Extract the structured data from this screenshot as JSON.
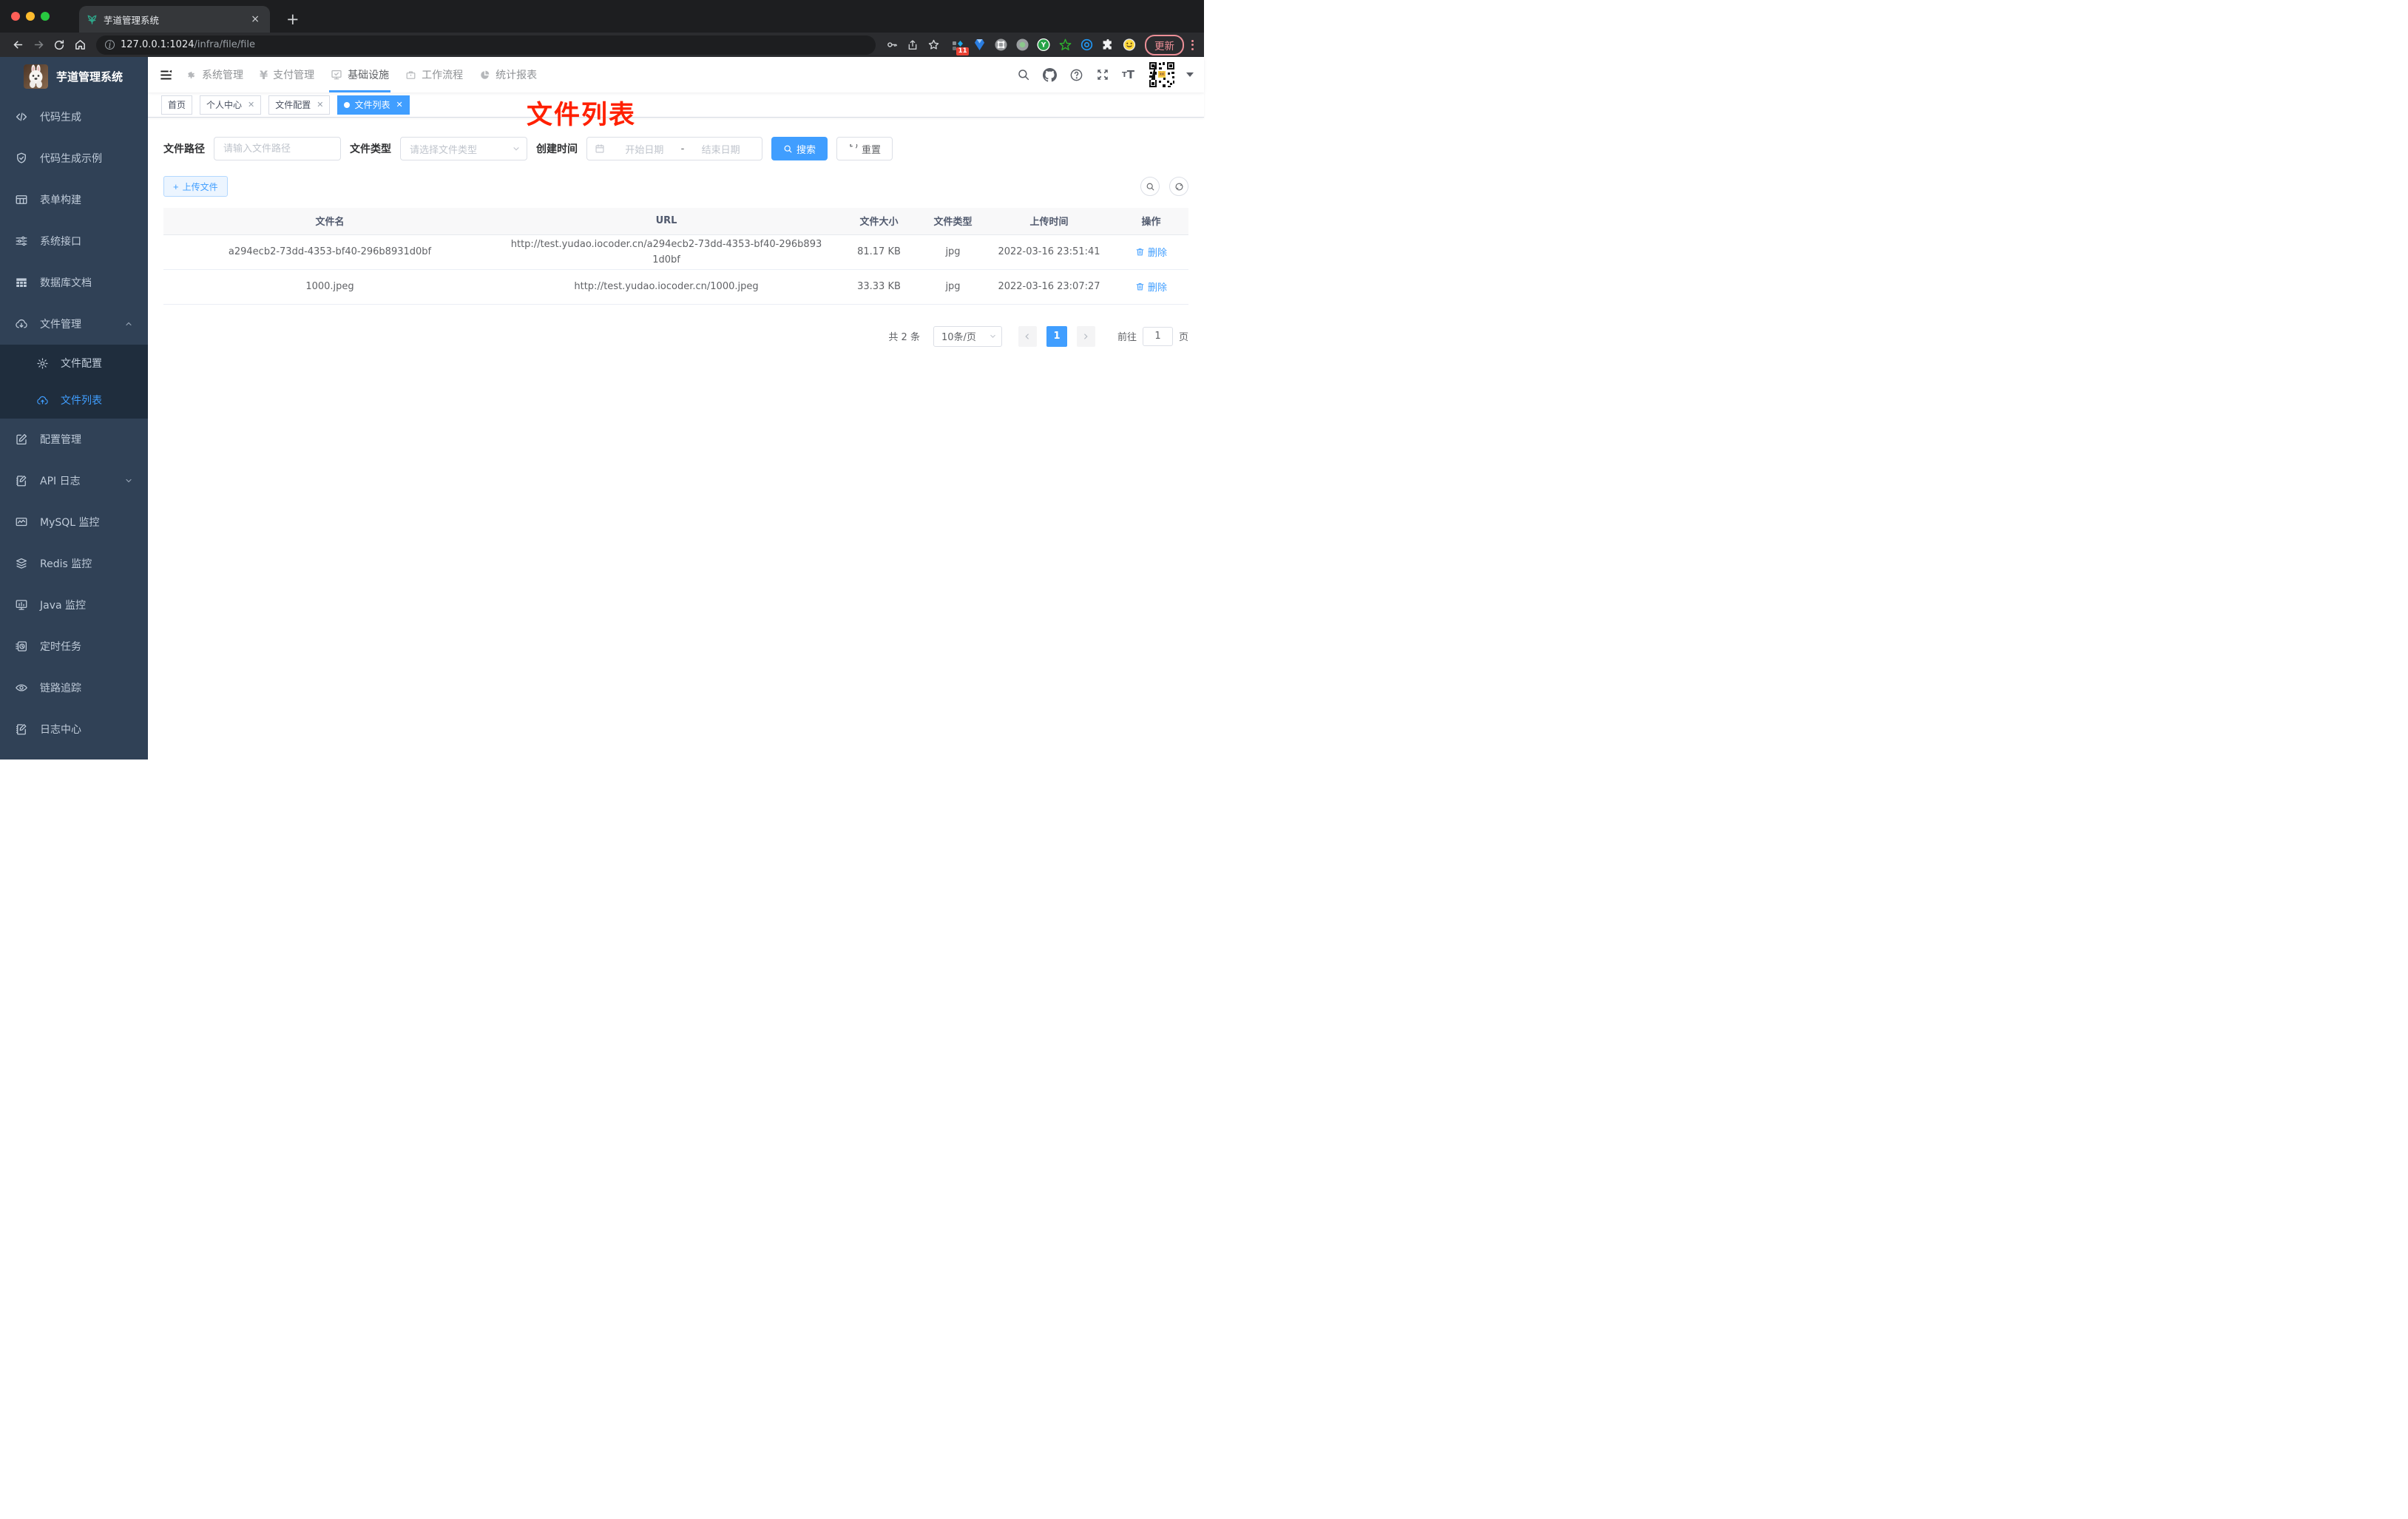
{
  "colors": {
    "accent": "#409eff",
    "sidebar_bg": "#304156",
    "submenu_bg": "#1f2d3d",
    "sidebar_text": "#bfcbd9",
    "annotation_red": "#ff2000",
    "table_header_bg": "#f8f8f9"
  },
  "browser": {
    "tab_title": "芋道管理系统",
    "close_tab": "×",
    "new_tab": "+",
    "url_host": "127.0.0.1:1024",
    "url_path": "/infra/file/file",
    "ext_badge": "11",
    "update_label": "更新"
  },
  "sidebar": {
    "title": "芋道管理系统",
    "items": [
      {
        "label": "代码生成",
        "icon": "code-icon"
      },
      {
        "label": "代码生成示例",
        "icon": "shield-check-icon"
      },
      {
        "label": "表单构建",
        "icon": "form-grid-icon"
      },
      {
        "label": "系统接口",
        "icon": "sliders-icon"
      },
      {
        "label": "数据库文档",
        "icon": "db-table-icon"
      },
      {
        "label": "文件管理",
        "icon": "cloud-download-icon",
        "expanded": true
      },
      {
        "label": "文件配置",
        "icon": "gear-icon",
        "sub": true
      },
      {
        "label": "文件列表",
        "icon": "cloud-upload-icon",
        "sub": true,
        "active": true
      },
      {
        "label": "配置管理",
        "icon": "edit-icon"
      },
      {
        "label": "API 日志",
        "icon": "log-edit-icon",
        "collapsed": true
      },
      {
        "label": "MySQL 监控",
        "icon": "chart-monitor-icon"
      },
      {
        "label": "Redis 监控",
        "icon": "layers-icon"
      },
      {
        "label": "Java 监控",
        "icon": "monitor-bars-icon"
      },
      {
        "label": "定时任务",
        "icon": "schedule-icon"
      },
      {
        "label": "链路追踪",
        "icon": "eye-icon"
      },
      {
        "label": "日志中心",
        "icon": "log-edit-icon"
      }
    ]
  },
  "topnav": {
    "items": [
      {
        "label": "系统管理",
        "icon": "gear-icon"
      },
      {
        "label": "支付管理",
        "icon": "yen-icon"
      },
      {
        "label": "基础设施",
        "icon": "monitor-check-icon",
        "active": true
      },
      {
        "label": "工作流程",
        "icon": "briefcase-icon"
      },
      {
        "label": "统计报表",
        "icon": "pie-chart-icon"
      }
    ]
  },
  "tags": [
    {
      "label": "首页",
      "closable": false
    },
    {
      "label": "个人中心",
      "closable": true
    },
    {
      "label": "文件配置",
      "closable": true
    },
    {
      "label": "文件列表",
      "closable": true,
      "active": true
    }
  ],
  "annotation": "文件列表",
  "filters": {
    "path_label": "文件路径",
    "path_placeholder": "请输入文件路径",
    "type_label": "文件类型",
    "type_placeholder": "请选择文件类型",
    "date_label": "创建时间",
    "date_start": "开始日期",
    "date_separator": "-",
    "date_end": "结束日期",
    "search_label": "搜索",
    "reset_label": "重置"
  },
  "toolbar": {
    "upload_label": "上传文件"
  },
  "table": {
    "headers": [
      "文件名",
      "URL",
      "文件大小",
      "文件类型",
      "上传时间",
      "操作"
    ],
    "rows": [
      {
        "name": "a294ecb2-73dd-4353-bf40-296b8931d0bf",
        "url": "http://test.yudao.iocoder.cn/a294ecb2-73dd-4353-bf40-296b8931d0bf",
        "size": "81.17 KB",
        "type": "jpg",
        "time": "2022-03-16 23:51:41",
        "action": "删除"
      },
      {
        "name": "1000.jpeg",
        "url": "http://test.yudao.iocoder.cn/1000.jpeg",
        "size": "33.33 KB",
        "type": "jpg",
        "time": "2022-03-16 23:07:27",
        "action": "删除"
      }
    ]
  },
  "pagination": {
    "total": "共 2 条",
    "page_size": "10条/页",
    "current_page": "1",
    "goto_label": "前往",
    "goto_value": "1",
    "unit_label": "页"
  }
}
